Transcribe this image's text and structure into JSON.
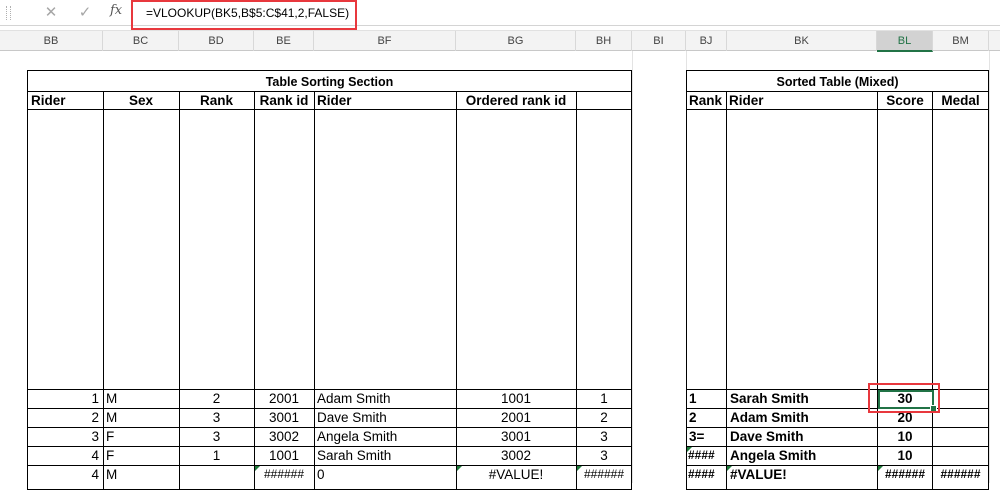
{
  "formula_bar": {
    "formula": "=VLOOKUP(BK5,B$5:C$41,2,FALSE)",
    "cancel_icon": "close-icon",
    "enter_icon": "check-icon",
    "fx_label": "fx"
  },
  "columns": [
    "BB",
    "BC",
    "BD",
    "BE",
    "BF",
    "BG",
    "BH",
    "BI",
    "BJ",
    "BK",
    "BL",
    "BM"
  ],
  "selected_column": "BL",
  "sorting_table": {
    "title": "Table Sorting Section",
    "headers": [
      "Rider",
      "Sex",
      "Rank",
      "Rank id",
      "Rider",
      "Ordered rank  id",
      ""
    ],
    "rows": [
      {
        "rider": "1",
        "sex": "M",
        "rank": "2",
        "rank_id": "2001",
        "name": "Adam Smith",
        "ordered": "1001",
        "last": "1"
      },
      {
        "rider": "2",
        "sex": "M",
        "rank": "3",
        "rank_id": "3001",
        "name": "Dave Smith",
        "ordered": "2001",
        "last": "2"
      },
      {
        "rider": "3",
        "sex": "F",
        "rank": "3",
        "rank_id": "3002",
        "name": "Angela Smith",
        "ordered": "3001",
        "last": "3"
      },
      {
        "rider": "4",
        "sex": "F",
        "rank": "1",
        "rank_id": "1001",
        "name": "Sarah Smith",
        "ordered": "3002",
        "last": "3"
      },
      {
        "rider": "4",
        "sex": "M",
        "rank": "",
        "rank_id": "######",
        "name": "0",
        "ordered": "#VALUE!",
        "last": "######"
      }
    ]
  },
  "sorted_table": {
    "title": "Sorted Table (Mixed)",
    "headers": [
      "Rank",
      "Rider",
      "Score",
      "Medal"
    ],
    "rows": [
      {
        "rank": "1",
        "rider": "Sarah Smith",
        "score": "30",
        "medal": ""
      },
      {
        "rank": "2",
        "rider": "Adam Smith",
        "score": "20",
        "medal": ""
      },
      {
        "rank": "3=",
        "rider": "Dave Smith",
        "score": "10",
        "medal": ""
      },
      {
        "rank": "####",
        "rider": "Angela Smith",
        "score": "10",
        "medal": ""
      },
      {
        "rank": "####",
        "rider": "#VALUE!",
        "score": "######",
        "medal": "######"
      }
    ]
  }
}
